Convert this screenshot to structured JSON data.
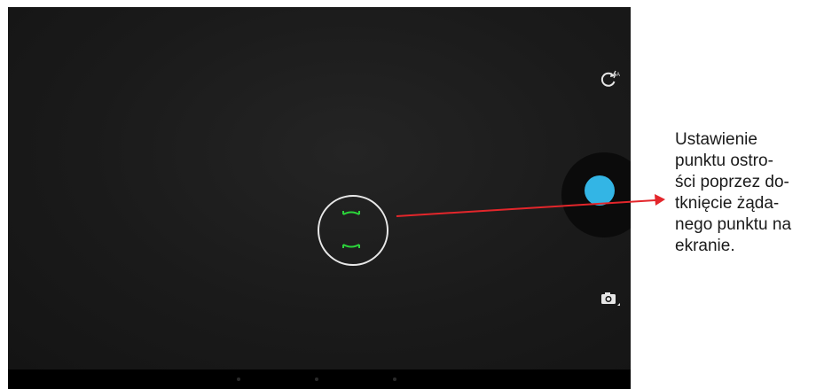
{
  "camera_app": {
    "flash_control": {
      "icon": "flash-auto-icon",
      "badge": "A"
    },
    "shutter": {
      "icon": "shutter-icon",
      "color": "#33b5e5"
    },
    "mode_switch": {
      "icon": "camera-mode-icon"
    },
    "focus_indicator": {
      "icon": "focus-ring-icon",
      "bracket_color": "#2bd13a",
      "ring_color": "#e8e8e8"
    },
    "navigation_bar": {
      "icons": [
        "nav-back-icon",
        "nav-home-icon",
        "nav-recents-icon"
      ]
    }
  },
  "annotation": {
    "text": "Ustawienie\npunktu ostro-\nści poprzez do-\ntknięcie żąda-\nnego punktu na\nekranie.",
    "arrow_color": "#e3262b"
  }
}
